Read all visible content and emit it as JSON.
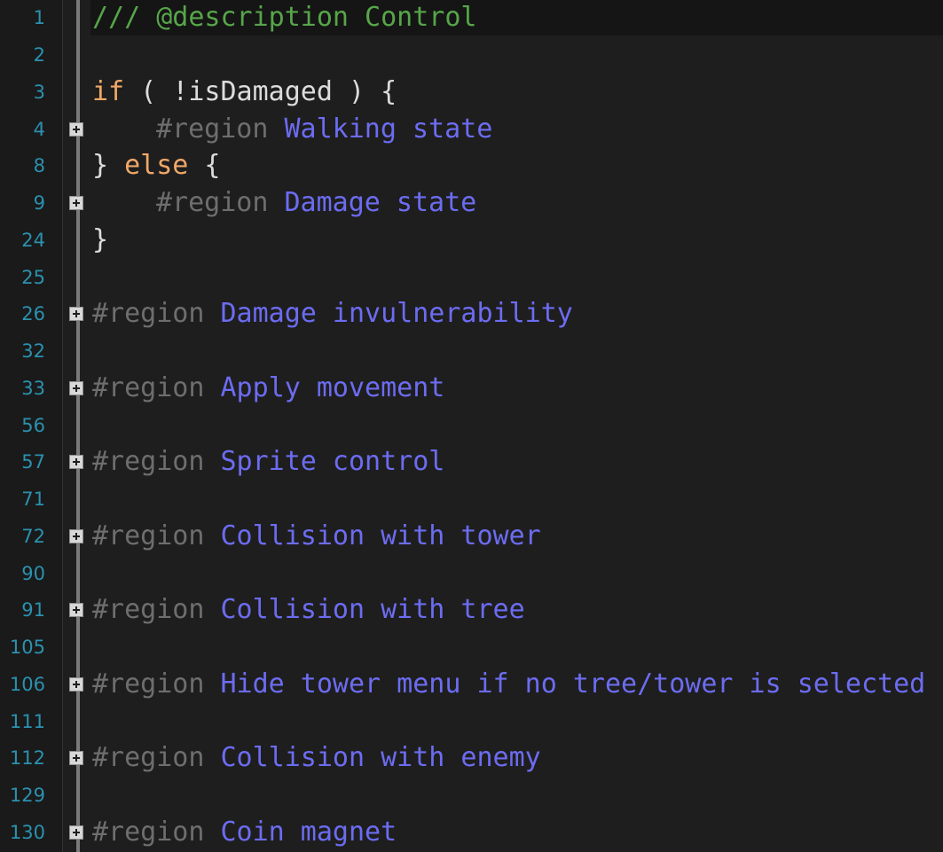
{
  "editor": {
    "lines": [
      {
        "num": "1",
        "comment": "/// @description Control"
      },
      {
        "num": "2"
      },
      {
        "num": "3",
        "kw": "if",
        "rest": " ( !isDamaged ) {"
      },
      {
        "num": "4",
        "region_kw": "#region",
        "region_name": "Walking state"
      },
      {
        "num": "8",
        "open": "} ",
        "kw": "else",
        "rest": " {"
      },
      {
        "num": "9",
        "region_kw": "#region",
        "region_name": "Damage state"
      },
      {
        "num": "24",
        "text": "}"
      },
      {
        "num": "25"
      },
      {
        "num": "26",
        "region_kw": "#region",
        "region_name": "Damage invulnerability"
      },
      {
        "num": "32"
      },
      {
        "num": "33",
        "region_kw": "#region",
        "region_name": "Apply movement"
      },
      {
        "num": "56"
      },
      {
        "num": "57",
        "region_kw": "#region",
        "region_name": "Sprite control"
      },
      {
        "num": "71"
      },
      {
        "num": "72",
        "region_kw": "#region",
        "region_name": "Collision with tower"
      },
      {
        "num": "90"
      },
      {
        "num": "91",
        "region_kw": "#region",
        "region_name": "Collision with tree"
      },
      {
        "num": "105"
      },
      {
        "num": "106",
        "region_kw": "#region",
        "region_name": "Hide tower menu if no tree/tower is selected"
      },
      {
        "num": "111"
      },
      {
        "num": "112",
        "region_kw": "#region",
        "region_name": "Collision with enemy"
      },
      {
        "num": "129"
      },
      {
        "num": "130",
        "region_kw": "#region",
        "region_name": "Coin magnet"
      }
    ]
  },
  "colors": {
    "background": "#1e1e1e",
    "line_number": "#2b91af",
    "comment": "#57a64a",
    "keyword": "#f0a868",
    "region_keyword": "#6e6e6e",
    "region_name": "#6c6cf2",
    "plain": "#dcdcdc"
  }
}
